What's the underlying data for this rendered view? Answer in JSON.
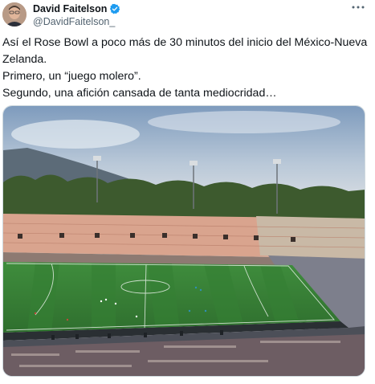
{
  "author": {
    "display_name": "David Faitelson",
    "handle": "@DavidFaitelson_",
    "verified": true,
    "avatar_icon": "profile-avatar"
  },
  "menu": {
    "more_icon": "more-horizontal-icon"
  },
  "tweet": {
    "lines": [
      "Así el Rose Bowl a poco más de 30 minutos del inicio del México-Nueva Zelanda.",
      "Primero, un “juego molero”.",
      "Segundo, una afición cansada de tanta mediocridad…"
    ]
  },
  "media": {
    "type": "photo",
    "colors": {
      "sky": "#9fb7cf",
      "pitch": "#3c8a3c",
      "stands": "#d9a48e",
      "verified": "#1d9bf0"
    }
  }
}
